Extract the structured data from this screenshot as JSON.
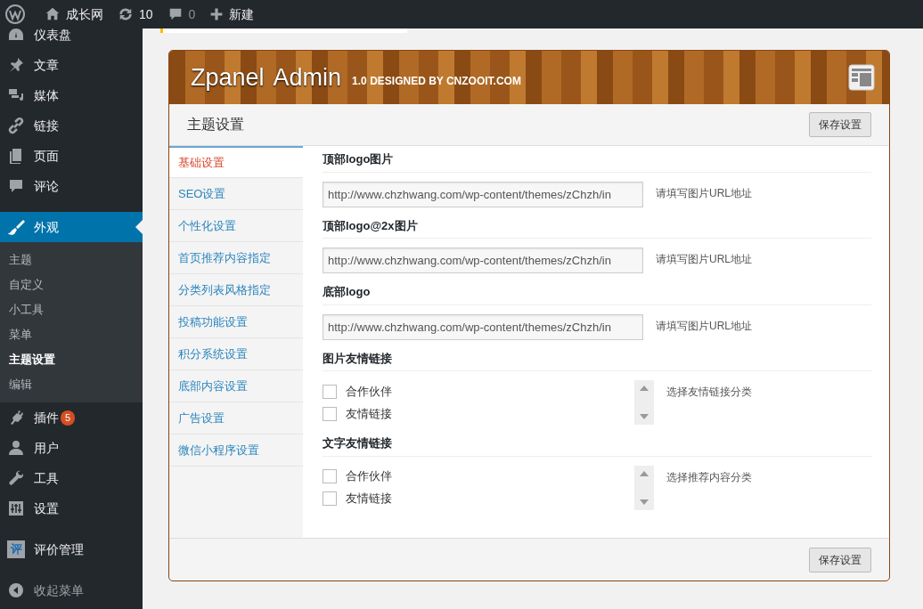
{
  "admin_bar": {
    "site": "成长网",
    "updates": "10",
    "comments": "0",
    "new": "新建"
  },
  "sidebar": {
    "groups": [
      [
        {
          "label": "仪表盘",
          "selected": false
        },
        {
          "label": "文章",
          "selected": false
        },
        {
          "label": "媒体",
          "selected": false
        },
        {
          "label": "链接",
          "selected": false
        },
        {
          "label": "页面",
          "selected": false
        },
        {
          "label": "评论",
          "selected": false
        }
      ],
      [
        {
          "label": "外观",
          "selected": true,
          "children": [
            {
              "label": "主题",
              "selected": false
            },
            {
              "label": "自定义",
              "selected": false
            },
            {
              "label": "小工具",
              "selected": false
            },
            {
              "label": "菜单",
              "selected": false
            },
            {
              "label": "主题设置",
              "selected": true
            },
            {
              "label": "编辑",
              "selected": false
            }
          ]
        },
        {
          "label": "插件",
          "selected": false,
          "badge": "5"
        },
        {
          "label": "用户",
          "selected": false
        },
        {
          "label": "工具",
          "selected": false
        },
        {
          "label": "设置",
          "selected": false
        }
      ],
      [
        {
          "label": "评价管理",
          "selected": false,
          "icon_text": "评"
        }
      ]
    ],
    "collapse": "收起菜单"
  },
  "panel": {
    "title": "Zpanel  Admin",
    "version": "1.0 DESIGNED BY CNZOOIT.COM",
    "section_title": "主题设置",
    "save_button": "保存设置",
    "tabs": [
      {
        "label": "基础设置",
        "selected": true
      },
      {
        "label": "SEO设置",
        "selected": false
      },
      {
        "label": "个性化设置",
        "selected": false
      },
      {
        "label": "首页推荐内容指定",
        "selected": false
      },
      {
        "label": "分类列表风格指定",
        "selected": false
      },
      {
        "label": "投稿功能设置",
        "selected": false
      },
      {
        "label": "积分系统设置",
        "selected": false
      },
      {
        "label": "底部内容设置",
        "selected": false
      },
      {
        "label": "广告设置",
        "selected": false
      },
      {
        "label": "微信小程序设置",
        "selected": false
      }
    ],
    "fields": [
      {
        "kind": "text",
        "label": "顶部logo图片",
        "value": "http://www.chzhwang.com/wp-content/themes/zChzh/in",
        "help": "请填写图片URL地址"
      },
      {
        "kind": "text",
        "label": "顶部logo@2x图片",
        "value": "http://www.chzhwang.com/wp-content/themes/zChzh/in",
        "help": "请填写图片URL地址"
      },
      {
        "kind": "text",
        "label": "底部logo",
        "value": "http://www.chzhwang.com/wp-content/themes/zChzh/in",
        "help": "请填写图片URL地址"
      },
      {
        "kind": "checklist",
        "label": "图片友情链接",
        "options": [
          {
            "label": "合作伙伴",
            "checked": false
          },
          {
            "label": "友情链接",
            "checked": false
          }
        ],
        "help": "选择友情链接分类"
      },
      {
        "kind": "checklist",
        "label": "文字友情链接",
        "options": [
          {
            "label": "合作伙伴",
            "checked": false
          },
          {
            "label": "友情链接",
            "checked": false
          }
        ],
        "help": "选择推荐内容分类"
      }
    ],
    "footer_save": "保存设置"
  }
}
